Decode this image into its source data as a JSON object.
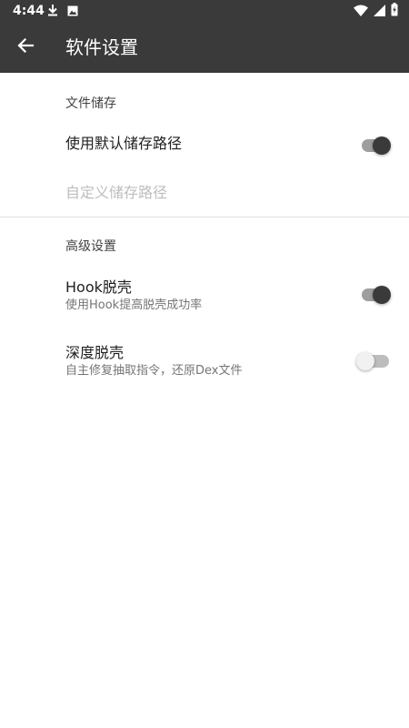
{
  "status_bar": {
    "time": "4:44",
    "left_icons": [
      "download-icon",
      "photo-icon"
    ],
    "right_icons": [
      "wifi-icon",
      "signal-icon",
      "battery-charging-icon"
    ]
  },
  "app_bar": {
    "back_icon": "arrow-back-icon",
    "title": "软件设置",
    "background": "#3a3a3a"
  },
  "sections": [
    {
      "header": "文件储存",
      "items": [
        {
          "title": "使用默认储存路径",
          "summary": "",
          "switch": true,
          "checked": true,
          "enabled": true
        },
        {
          "title": "自定义储存路径",
          "summary": "",
          "switch": false,
          "enabled": false
        }
      ]
    },
    {
      "header": "高级设置",
      "items": [
        {
          "title": "Hook脱壳",
          "summary": "使用Hook提高脱壳成功率",
          "switch": true,
          "checked": true,
          "enabled": true
        },
        {
          "title": "深度脱壳",
          "summary": "自主修复抽取指令，还原Dex文件",
          "switch": true,
          "checked": false,
          "enabled": true
        }
      ]
    }
  ],
  "colors": {
    "toolbar": "#3a3a3a",
    "switch_on_thumb": "#3a3a3a",
    "switch_on_track": "#9e9e9e",
    "switch_off_thumb": "#f1f1f1",
    "switch_off_track": "#bdbdbd",
    "disabled_text": "#bdbdbd",
    "summary_text": "#757575"
  }
}
